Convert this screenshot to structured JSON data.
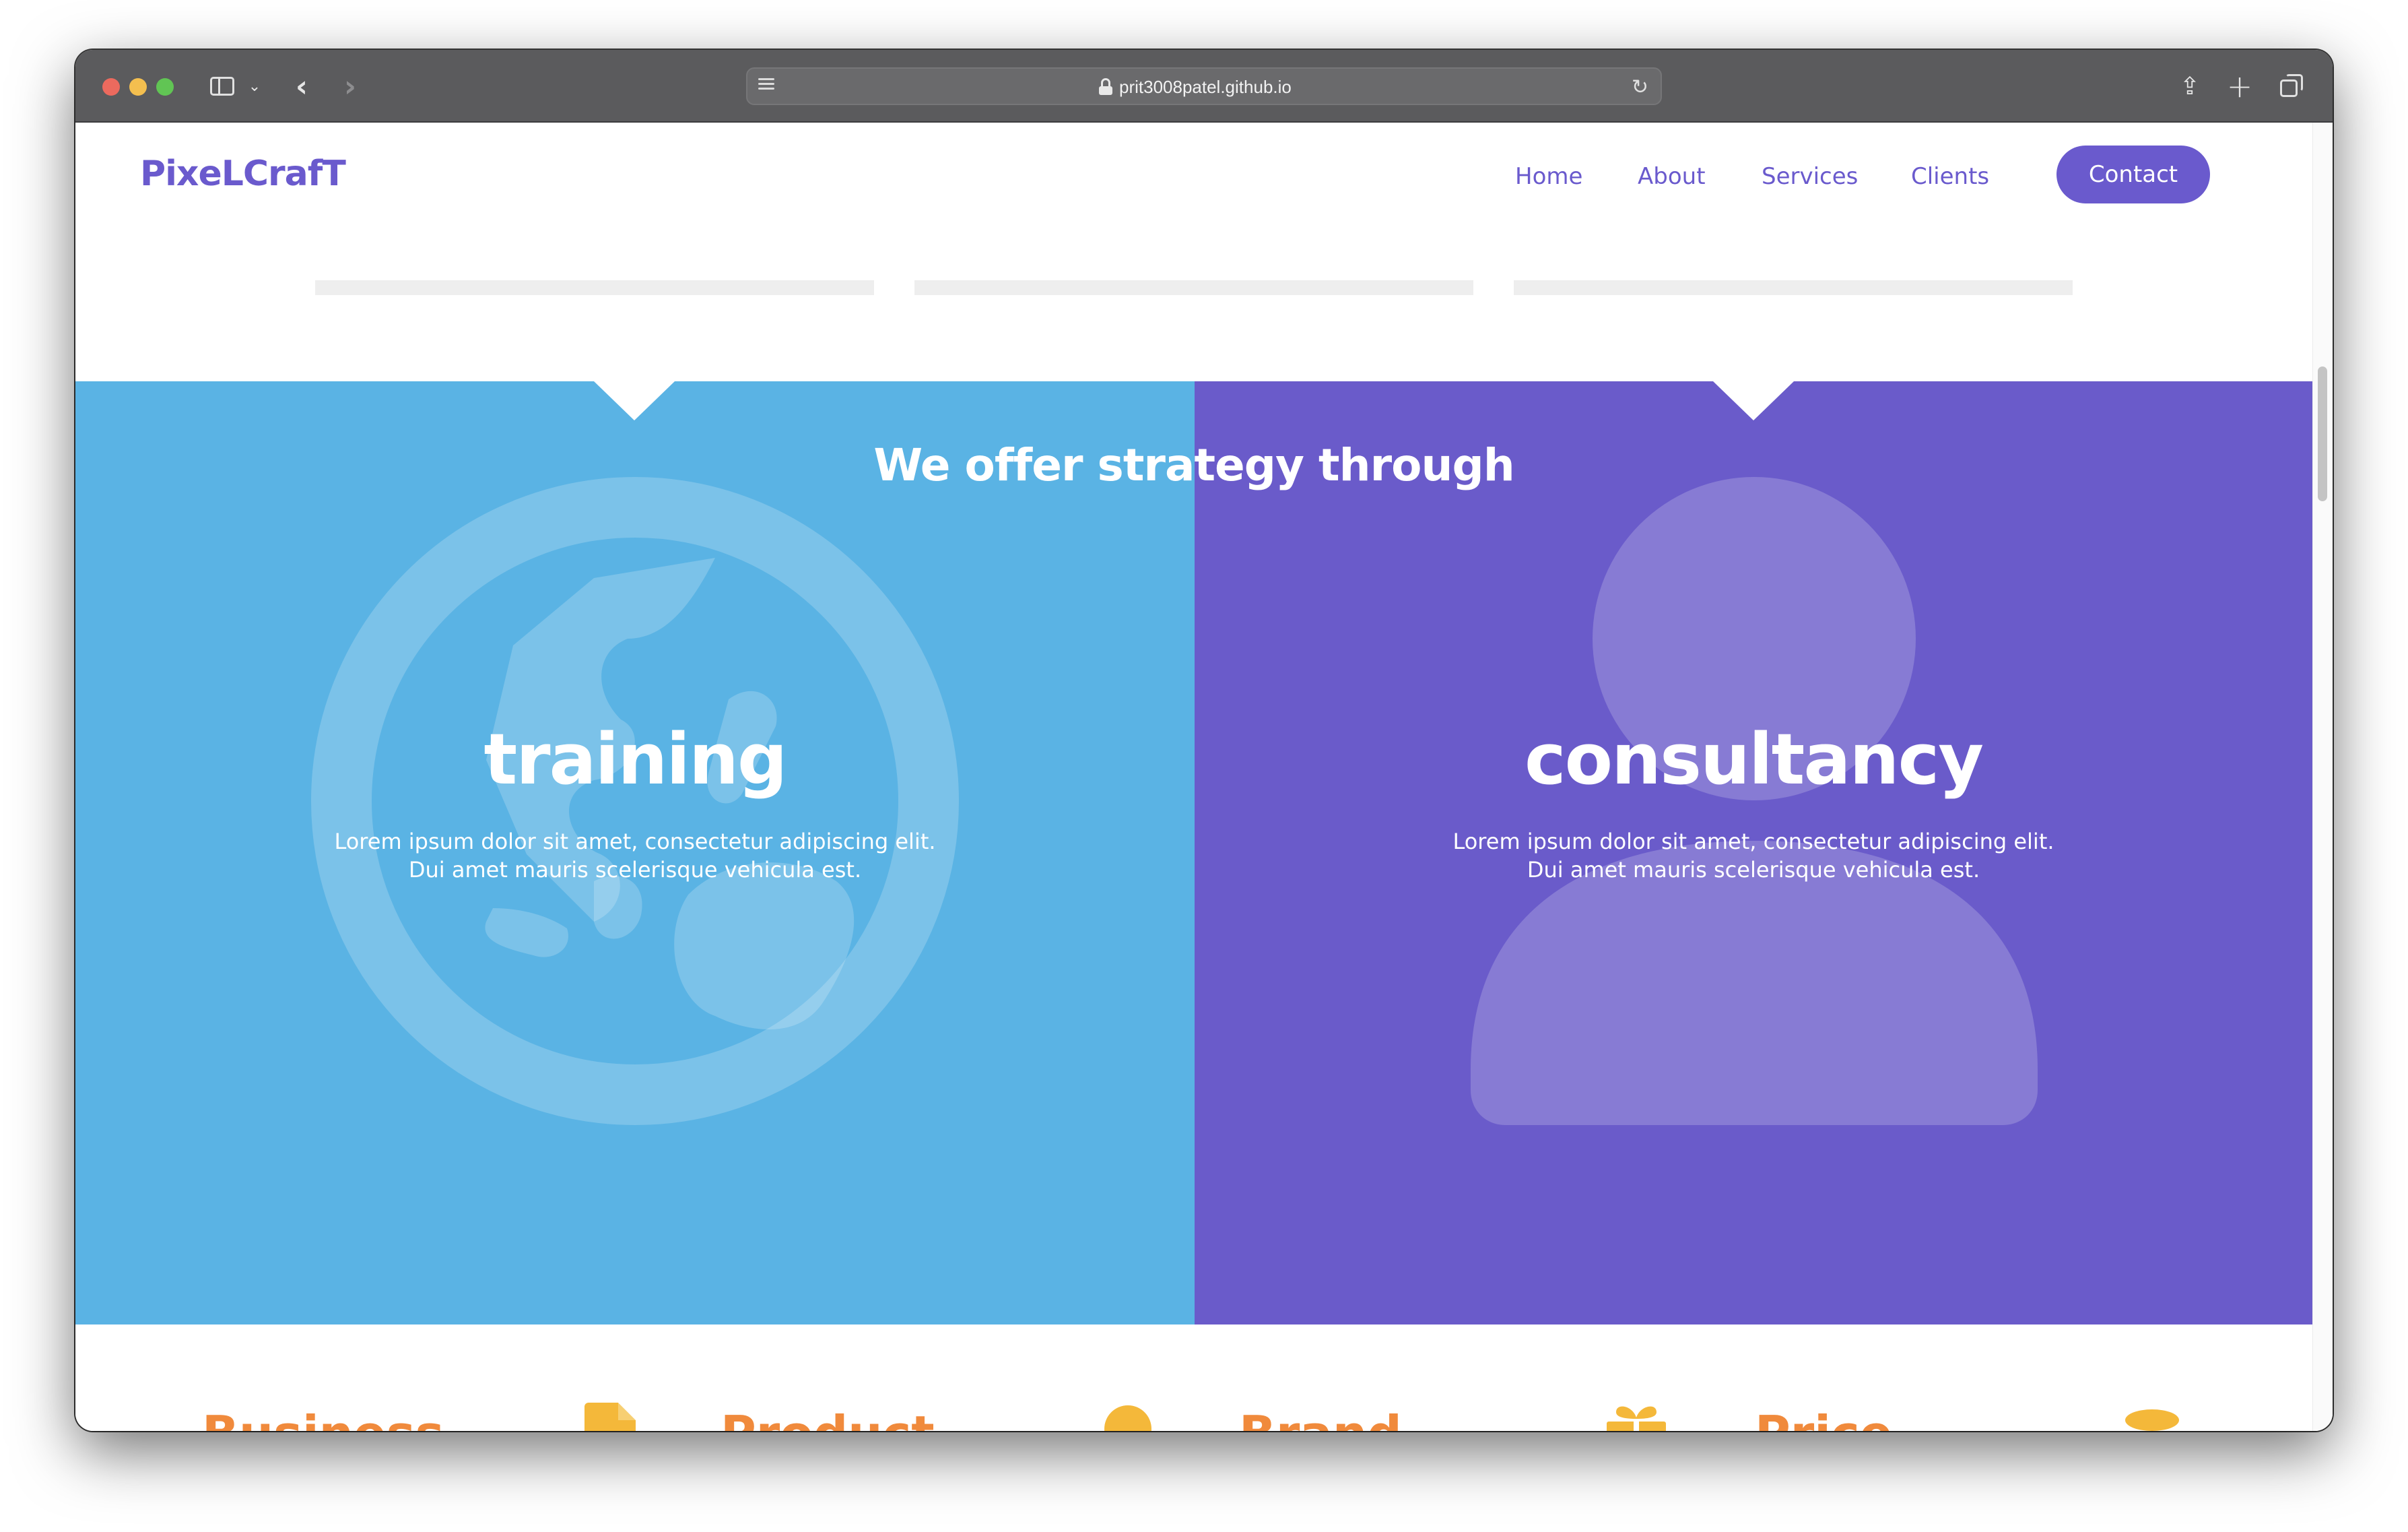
{
  "browser": {
    "url": "prit3008patel.github.io"
  },
  "site": {
    "logo": "PixeLCrafT",
    "nav": {
      "home": "Home",
      "about": "About",
      "services": "Services",
      "clients": "Clients",
      "contact": "Contact"
    }
  },
  "strategy": {
    "title": "We offer strategy through",
    "left": {
      "heading": "training",
      "line1": "Lorem ipsum dolor sit amet, consectetur adipiscing elit.",
      "line2": "Dui amet mauris scelerisque vehicula est."
    },
    "right": {
      "heading": "consultancy",
      "line1": "Lorem ipsum dolor sit amet, consectetur adipiscing elit.",
      "line2": "Dui amet mauris scelerisque vehicula est."
    }
  },
  "features": [
    "Business",
    "Product",
    "Brand",
    "Price"
  ],
  "colors": {
    "brand": "#6a5acd",
    "training_bg": "#5ab3e4",
    "consultancy_bg": "#6a5bca",
    "feature_title": "#f08a3c",
    "feature_icon": "#f4b83a"
  }
}
